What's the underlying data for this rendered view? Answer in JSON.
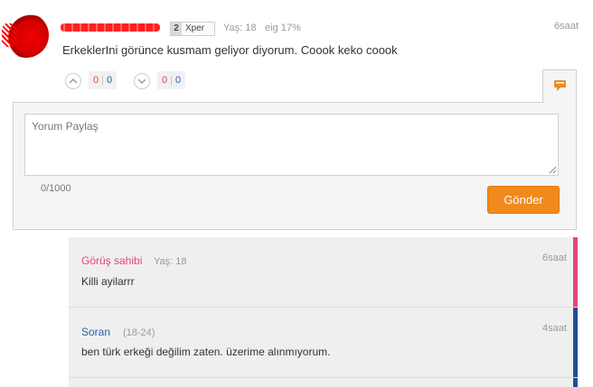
{
  "comment": {
    "level": "2",
    "level_label": "Xper",
    "age": "Yaş: 18",
    "eig": "eig 17%",
    "time": "6saat",
    "text": "ErkeklerIni görünce kusmam geliyor diyorum. Coook keko coook",
    "votes_up": {
      "red": "0",
      "blue": "0"
    },
    "votes_down": {
      "red": "0",
      "blue": "0"
    }
  },
  "form": {
    "placeholder": "Yorum Paylaş",
    "counter": "0/1000",
    "submit_label": "Gönder"
  },
  "replies": [
    {
      "name": "Görüş sahibi",
      "meta": "Yaş: 18",
      "time": "6saat",
      "text": "Killi ayilarrr",
      "name_color": "#e0467c",
      "stripe_color": "#e0467c"
    },
    {
      "name": "Soran",
      "meta": "(18-24)",
      "time": "4saat",
      "text": "ben türk erkeği değilim zaten. üzerime alınmıyorum.",
      "name_color": "#2a5fa8",
      "stripe_color": "#1f4e96"
    }
  ],
  "colors": {
    "accent": "#f18a1d",
    "pink": "#e0467c",
    "blue": "#2a5fa8"
  }
}
